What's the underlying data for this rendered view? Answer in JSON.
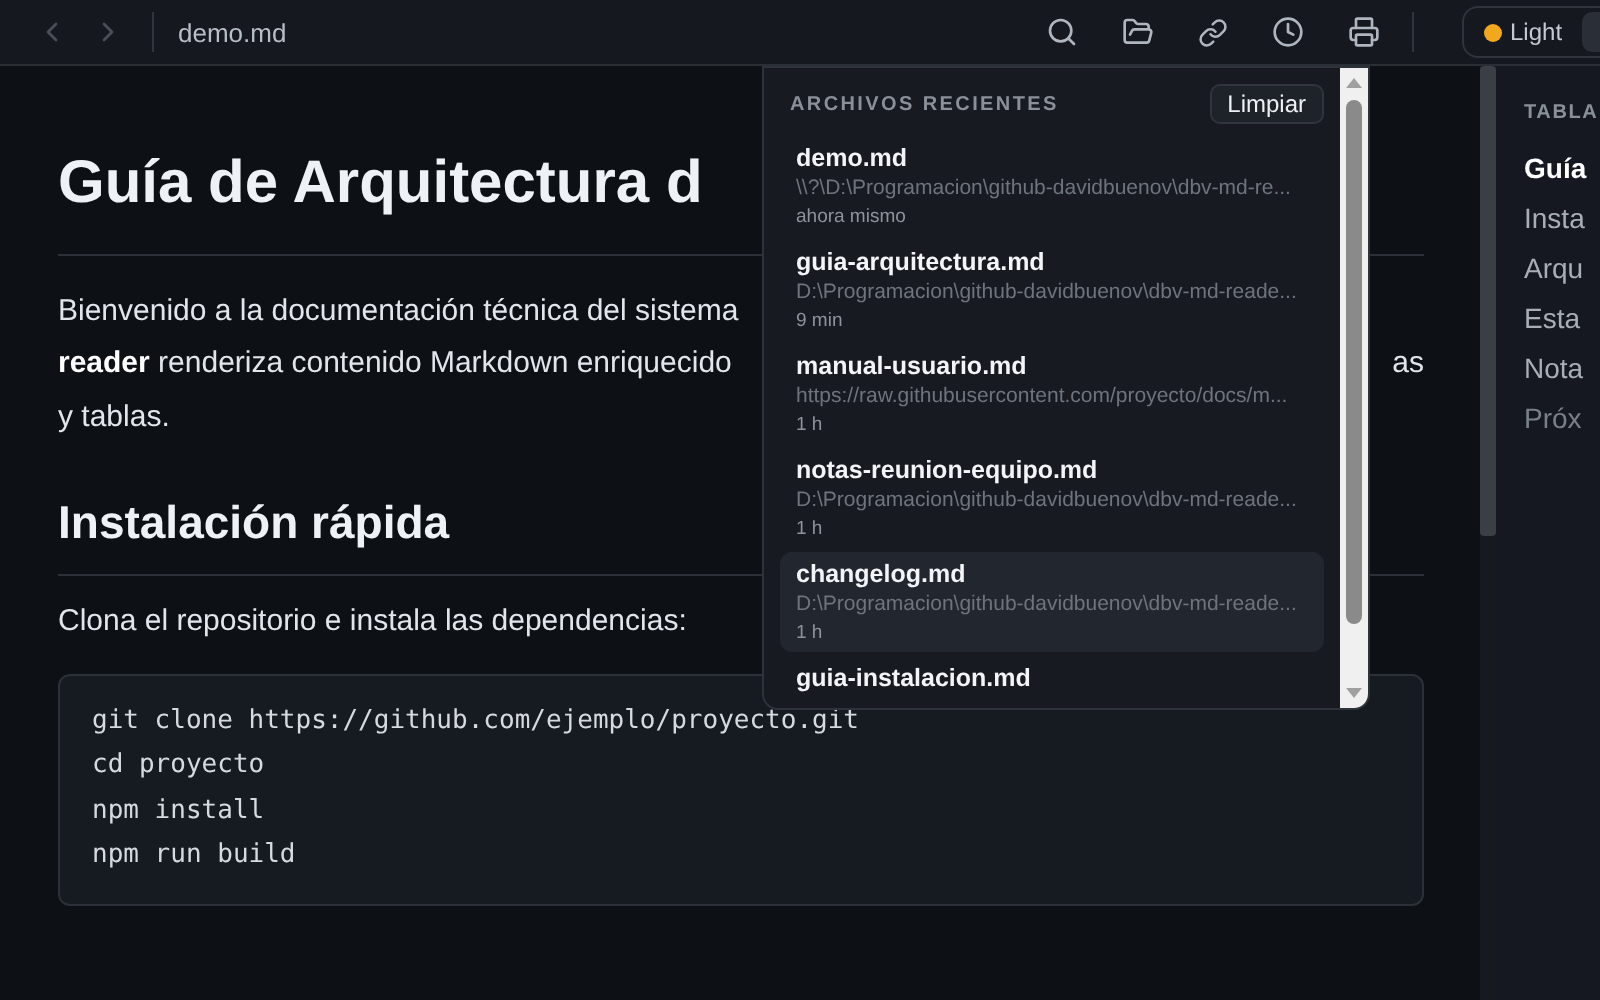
{
  "toolbar": {
    "back_disabled": true,
    "forward_disabled": true,
    "file_name": "demo.md",
    "theme_toggle": {
      "label": "Light",
      "selected": false
    }
  },
  "document": {
    "title": "Guía de Arquitectura d",
    "intro_lines": [
      {
        "text": "Bienvenido a la documentación técnica del sistema"
      },
      {
        "text": "**reader** renderiza contenido Markdown enriquecido",
        "tail": "as"
      },
      {
        "text": "y tablas."
      }
    ],
    "section_title": "Instalación rápida",
    "section_text": "Clona el repositorio e instala las dependencias:",
    "code_lines": [
      "git clone https://github.com/ejemplo/proyecto.git",
      "cd proyecto",
      "npm install",
      "npm run build"
    ]
  },
  "recent_files": {
    "title": "ARCHIVOS RECIENTES",
    "clear_button": "Limpiar",
    "items": [
      {
        "name": "demo.md",
        "path": "\\\\?\\D:\\Programacion\\github-davidbuenov\\dbv-md-re...",
        "time": "ahora mismo",
        "selected": false
      },
      {
        "name": "guia-arquitectura.md",
        "path": "D:\\Programacion\\github-davidbuenov\\dbv-md-reade...",
        "time": "9 min",
        "selected": false
      },
      {
        "name": "manual-usuario.md",
        "path": "https://raw.githubusercontent.com/proyecto/docs/m...",
        "time": "1 h",
        "selected": false
      },
      {
        "name": "notas-reunion-equipo.md",
        "path": "D:\\Programacion\\github-davidbuenov\\dbv-md-reade...",
        "time": "1 h",
        "selected": false
      },
      {
        "name": "changelog.md",
        "path": "D:\\Programacion\\github-davidbuenov\\dbv-md-reade...",
        "time": "1 h",
        "selected": true
      },
      {
        "name": "guia-instalacion.md",
        "selected": false
      }
    ]
  },
  "toc": {
    "title": "TABLA",
    "items": [
      {
        "label": "Guía",
        "selected": true
      },
      {
        "label": "Insta",
        "selected": false
      },
      {
        "label": "Arqu",
        "selected": false
      },
      {
        "label": "Esta",
        "selected": false
      },
      {
        "label": "Nota",
        "selected": false
      },
      {
        "label": "Próx",
        "selected": false,
        "dim": true
      }
    ]
  }
}
